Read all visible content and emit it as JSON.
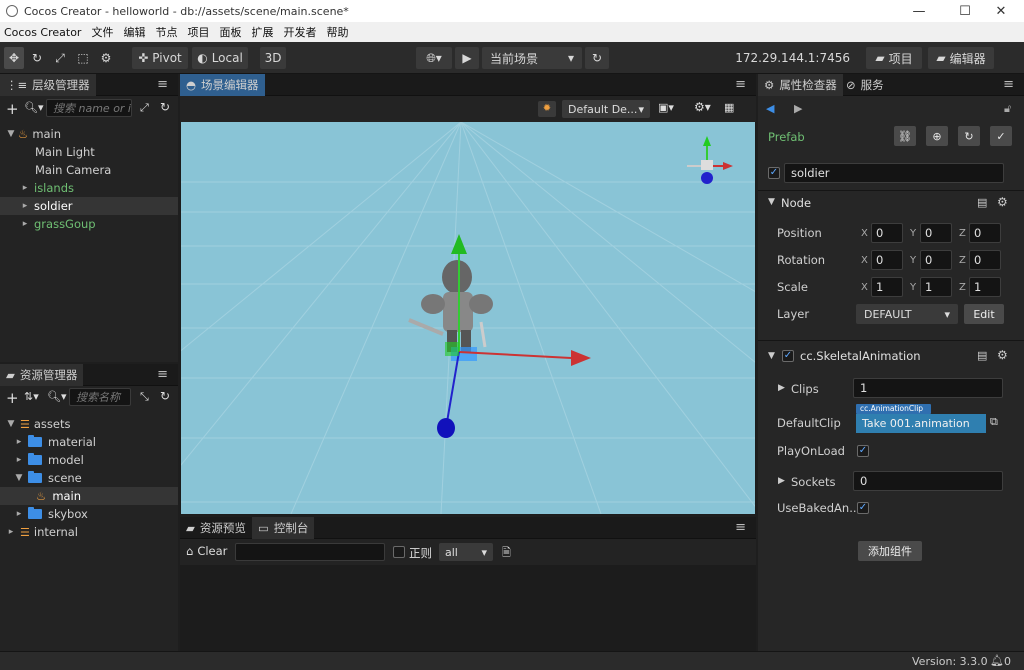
{
  "window": {
    "title": "Cocos Creator - helloworld - db://assets/scene/main.scene*",
    "minimize": "—",
    "maximize": "☐",
    "close": "✕"
  },
  "menu": [
    "Cocos Creator",
    "文件",
    "编辑",
    "节点",
    "项目",
    "面板",
    "扩展",
    "开发者",
    "帮助"
  ],
  "toolbar": {
    "pivot": "Pivot",
    "local": "Local",
    "mode3d": "3D",
    "scene_select": "当前场景",
    "ip": "172.29.144.1:7456",
    "project_btn": "项目",
    "editor_btn": "编辑器"
  },
  "hierarchy": {
    "title": "层级管理器",
    "search_placeholder": "搜索 name or i",
    "items": [
      {
        "label": "main",
        "depth": 0,
        "expanded": true,
        "icon": "flame-icon"
      },
      {
        "label": "Main Light",
        "depth": 1
      },
      {
        "label": "Main Camera",
        "depth": 1
      },
      {
        "label": "islands",
        "depth": 1,
        "prefab": true
      },
      {
        "label": "soldier",
        "depth": 1,
        "prefab": true,
        "selected": true
      },
      {
        "label": "grassGoup",
        "depth": 1,
        "prefab": true
      }
    ]
  },
  "assets": {
    "title": "资源管理器",
    "search_placeholder": "搜索名称",
    "items": [
      {
        "label": "assets",
        "depth": 0,
        "expanded": true,
        "icon": "database-icon"
      },
      {
        "label": "material",
        "depth": 1,
        "icon": "folder-icon"
      },
      {
        "label": "model",
        "depth": 1,
        "icon": "folder-icon"
      },
      {
        "label": "scene",
        "depth": 1,
        "expanded": true,
        "icon": "folder-icon"
      },
      {
        "label": "main",
        "depth": 2,
        "icon": "flame-icon",
        "selected": true
      },
      {
        "label": "skybox",
        "depth": 1,
        "icon": "folder-icon"
      },
      {
        "label": "internal",
        "depth": 0,
        "icon": "database-icon"
      }
    ]
  },
  "scene": {
    "title": "场景编辑器",
    "camera_select": "Default De..."
  },
  "console": {
    "tab_preview": "资源预览",
    "tab_console": "控制台",
    "clear": "Clear",
    "regex": "正则",
    "level": "all"
  },
  "inspector": {
    "tab_inspector": "属性检查器",
    "tab_service": "服务",
    "prefab_label": "Prefab",
    "node_name": "soldier",
    "node_section": "Node",
    "position": {
      "label": "Position",
      "x": "0",
      "y": "0",
      "z": "0"
    },
    "rotation": {
      "label": "Rotation",
      "x": "0",
      "y": "0",
      "z": "0"
    },
    "scale": {
      "label": "Scale",
      "x": "1",
      "y": "1",
      "z": "1"
    },
    "layer": {
      "label": "Layer",
      "value": "DEFAULT",
      "edit": "Edit"
    },
    "component_title": "cc.SkeletalAnimation",
    "clips": {
      "label": "Clips",
      "value": "1"
    },
    "default_clip": {
      "label": "DefaultClip",
      "type": "cc.AnimationClip",
      "value": "Take 001.animation"
    },
    "play_on_load": "PlayOnLoad",
    "sockets": {
      "label": "Sockets",
      "value": "0"
    },
    "use_baked": "UseBakedAn...",
    "add_component": "添加组件"
  },
  "status": {
    "version": "Version: 3.3.0"
  },
  "colors": {
    "accent": "#2f7fd8",
    "viewport": "#89c4d6",
    "prefab": "#6fbf73"
  }
}
